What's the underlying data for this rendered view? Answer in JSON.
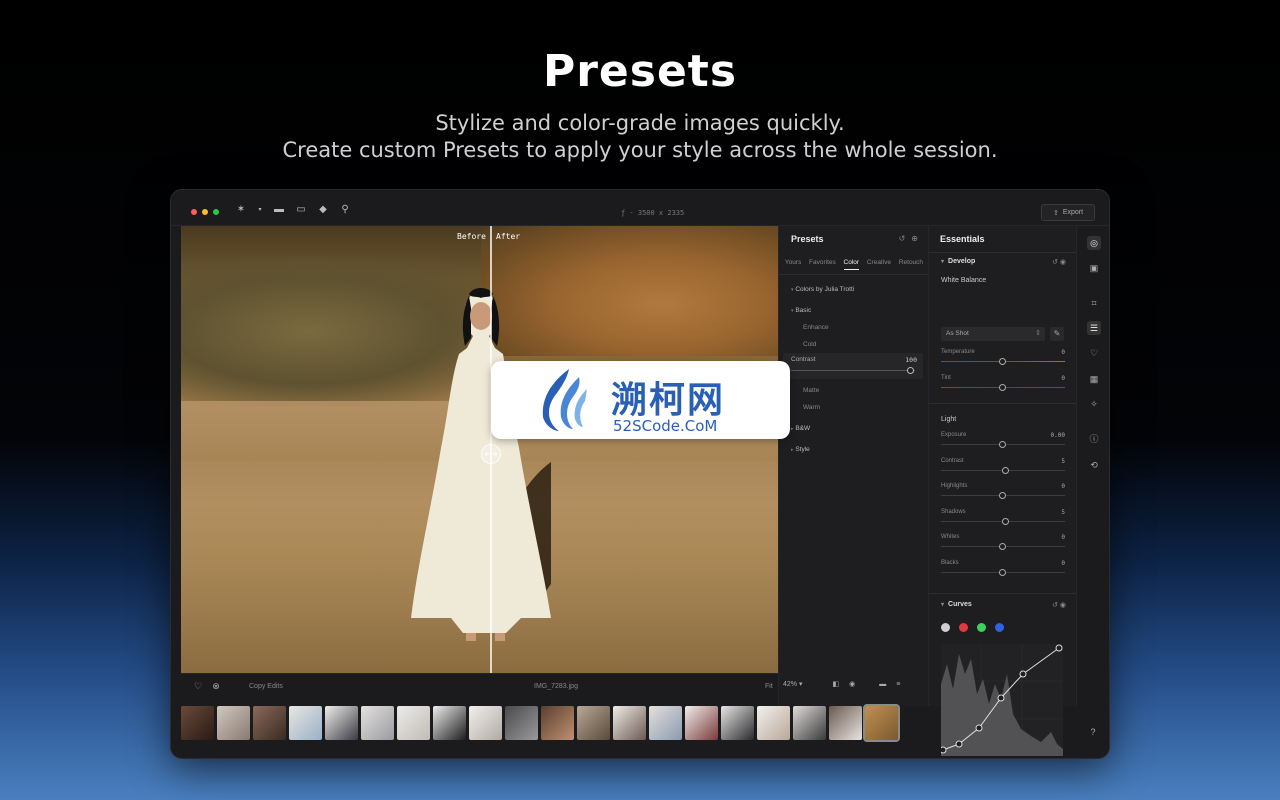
{
  "hero": {
    "title": "Presets",
    "subtitle_line1": "Stylize and color-grade images quickly.",
    "subtitle_line2": "Create custom Presets to apply your style across the whole session."
  },
  "titlebar": {
    "center_text": "ƒ  -  3500 x 2335",
    "export_label": "Export"
  },
  "viewer": {
    "before_label": "Before",
    "after_label": "After",
    "filename": "IMG_7283.jpg",
    "copy_edits_label": "Copy Edits",
    "fit_label": "Fit",
    "zoom": "42% ▾"
  },
  "presets": {
    "title": "Presets",
    "tabs": [
      "Yours",
      "Favorites",
      "Color",
      "Creative",
      "Retouch"
    ],
    "active_tab": "Color",
    "collection": "Colors by Julia Trotti",
    "group_basic": "Basic",
    "items": [
      "Enhance",
      "Cold"
    ],
    "contrast_label": "Contrast",
    "contrast_value": "100",
    "items_after": [
      "Matte",
      "Warm"
    ],
    "group_bw": "B&W",
    "group_style": "Style"
  },
  "essentials": {
    "title": "Essentials",
    "develop_label": "Develop",
    "white_balance_label": "White Balance",
    "wb_select": "As Shot",
    "temperature": {
      "label": "Temperature",
      "value": "0"
    },
    "tint": {
      "label": "Tint",
      "value": "0"
    },
    "light_label": "Light",
    "exposure": {
      "label": "Exposure",
      "value": "0.00"
    },
    "contrast": {
      "label": "Contrast",
      "value": "5"
    },
    "highlights": {
      "label": "Highlights",
      "value": "0"
    },
    "shadows": {
      "label": "Shadows",
      "value": "5"
    },
    "whites": {
      "label": "Whites",
      "value": "0"
    },
    "blacks": {
      "label": "Blacks",
      "value": "0"
    },
    "curves_label": "Curves",
    "curve_channels": [
      "#cfcfcf",
      "#e0393e",
      "#3ed160",
      "#2f63e0"
    ]
  },
  "watermark": {
    "cn": "溯柯网",
    "en": "52SCode.CoM"
  },
  "colors": {
    "accent_red": "#ff5f57",
    "accent_yellow": "#febc2e",
    "accent_green": "#28c840"
  }
}
